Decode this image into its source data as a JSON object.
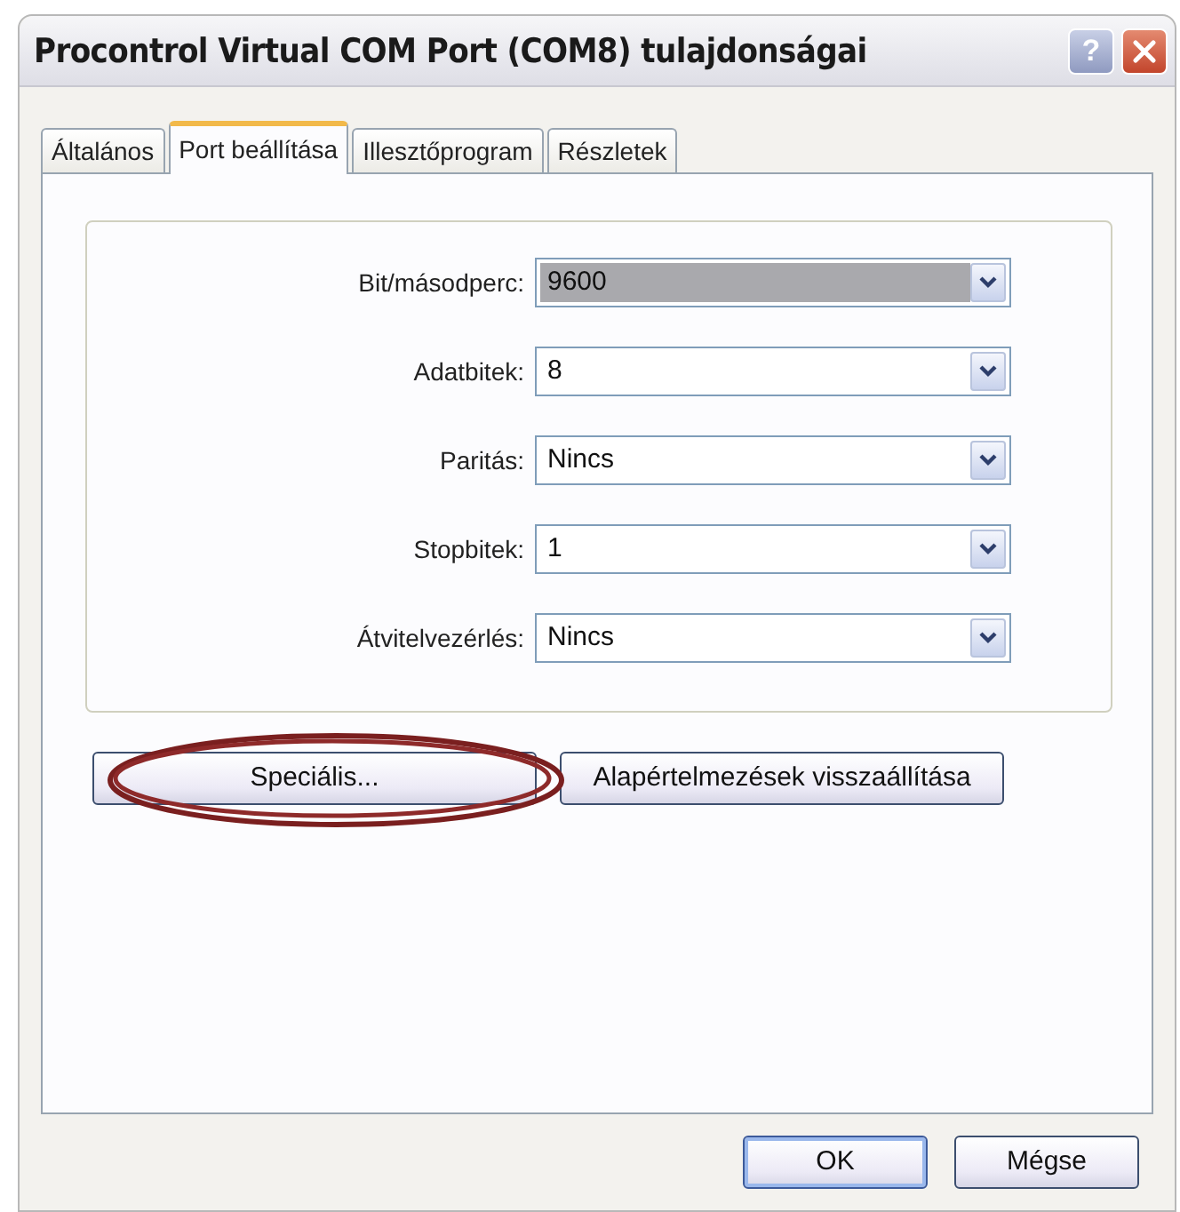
{
  "window": {
    "title": "Procontrol Virtual COM Port (COM8) tulajdonságai",
    "help_button": "?"
  },
  "tabs": [
    {
      "label": "Általános",
      "selected": false
    },
    {
      "label": "Port beállítása",
      "selected": true
    },
    {
      "label": "Illesztőprogram",
      "selected": false
    },
    {
      "label": "Részletek",
      "selected": false
    }
  ],
  "settings": [
    {
      "label": "Bit/másodperc:",
      "value": "9600",
      "focused": true
    },
    {
      "label": "Adatbitek:",
      "value": "8",
      "focused": false
    },
    {
      "label": "Paritás:",
      "value": "Nincs",
      "focused": false
    },
    {
      "label": "Stopbitek:",
      "value": "1",
      "focused": false
    },
    {
      "label": "Átvitelvezérlés:",
      "value": "Nincs",
      "focused": false
    }
  ],
  "panel_buttons": [
    {
      "label": "Speciális...",
      "highlighted": true
    },
    {
      "label": "Alapértelmezések visszaállítása",
      "highlighted": false
    }
  ],
  "dialog_buttons": [
    {
      "label": "OK",
      "default": true
    },
    {
      "label": "Mégse",
      "default": false
    }
  ]
}
